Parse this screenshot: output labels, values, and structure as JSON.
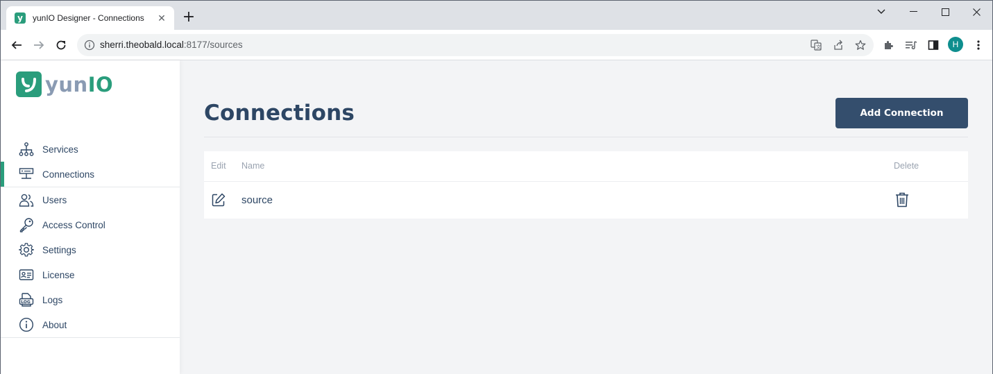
{
  "browser": {
    "tab_title": "yunIO Designer - Connections",
    "tab_favicon_letter": "y",
    "url_host": "sherri.theobald.local",
    "url_rest": ":8177/sources",
    "profile_initial": "H"
  },
  "app": {
    "logo_yun": "yun",
    "logo_io": "IO",
    "brand_color": "#2a9d7c"
  },
  "sidebar": {
    "items": [
      {
        "label": "Services",
        "icon": "sitemap-icon"
      },
      {
        "label": "Connections",
        "icon": "connections-icon",
        "active": true
      },
      {
        "label": "Users",
        "icon": "users-icon"
      },
      {
        "label": "Access Control",
        "icon": "key-icon"
      },
      {
        "label": "Settings",
        "icon": "gear-icon"
      },
      {
        "label": "License",
        "icon": "id-card-icon"
      },
      {
        "label": "Logs",
        "icon": "logs-icon"
      },
      {
        "label": "About",
        "icon": "info-icon"
      }
    ]
  },
  "main": {
    "title": "Connections",
    "add_button": "Add Connection",
    "table": {
      "headers": {
        "edit": "Edit",
        "name": "Name",
        "delete": "Delete"
      },
      "rows": [
        {
          "name": "source"
        }
      ]
    }
  }
}
